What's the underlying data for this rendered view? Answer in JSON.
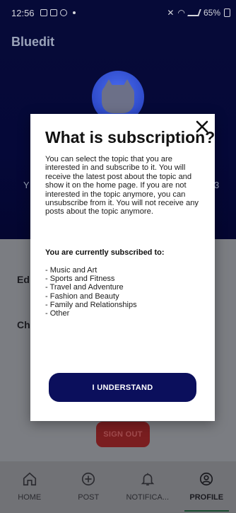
{
  "status_bar": {
    "time": "12:56",
    "battery": "65%"
  },
  "app": {
    "title": "Bluedit"
  },
  "header": {
    "left_fragment": "Y",
    "right_fragment": "3"
  },
  "menu": {
    "edit_fragment": "Ed",
    "change_fragment": "Ch"
  },
  "sign_out": {
    "label": "SIGN OUT"
  },
  "modal": {
    "title": "What is subscription?",
    "description": "You can select the topic that you are interested in and subscribe to it. You will receive the latest post about the topic and show it on the home page. If you are not interested in the topic anymore, you can unsubscribe from it. You will not receive any posts about the topic anymore.",
    "subscribed_heading": "You are currently subscribed to:",
    "topics": [
      "- Music and Art",
      "- Sports and Fitness",
      "- Travel and Adventure",
      "- Fashion and Beauty",
      "- Family and Relationships",
      "- Other"
    ],
    "button_label": "I UNDERSTAND",
    "close_icon": "close-icon"
  },
  "bottom_nav": {
    "items": [
      {
        "label": "HOME",
        "icon": "home-icon"
      },
      {
        "label": "POST",
        "icon": "plus-circle-icon"
      },
      {
        "label": "NOTIFICA...",
        "icon": "bell-icon"
      },
      {
        "label": "PROFILE",
        "icon": "profile-icon"
      }
    ],
    "active": "PROFILE"
  },
  "colors": {
    "header_bg": "#060a38",
    "button_bg": "#0b0f5c",
    "sign_out_bg": "#7a1e20"
  }
}
